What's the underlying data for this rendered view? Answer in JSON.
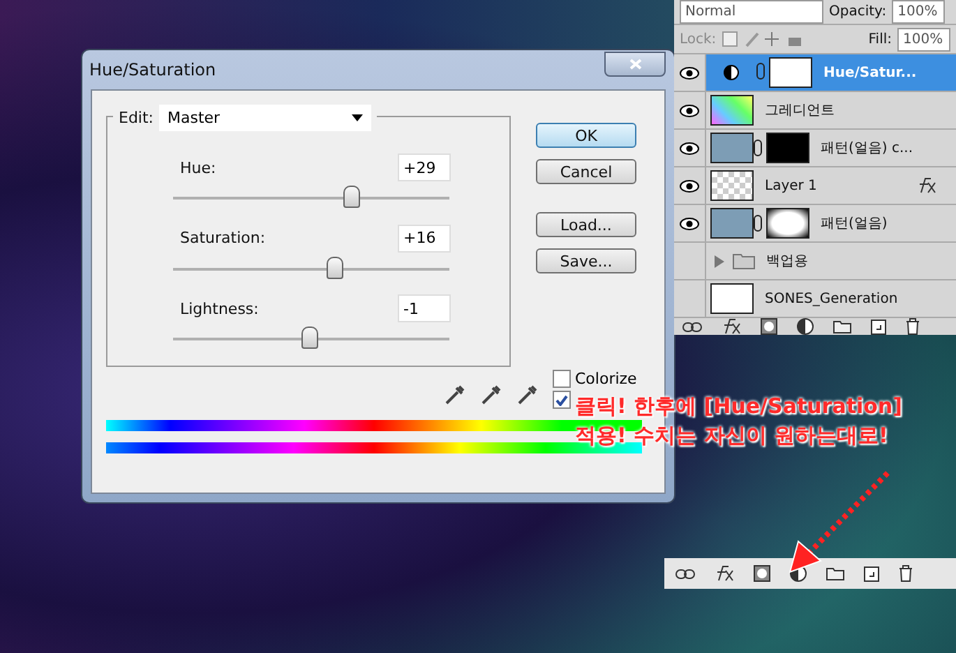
{
  "dialog": {
    "title": "Hue/Saturation",
    "edit_label": "Edit:",
    "edit_value": "Master",
    "sliders": [
      {
        "label": "Hue:",
        "value": "+29",
        "level": 0.64
      },
      {
        "label": "Saturation:",
        "value": "+16",
        "level": 0.58
      },
      {
        "label": "Lightness:",
        "value": "-1",
        "level": 0.49
      }
    ],
    "buttons": [
      {
        "label": "OK",
        "selected": true
      },
      {
        "label": "Cancel",
        "selected": false
      },
      {
        "label": "Load...",
        "selected": false
      },
      {
        "label": "Save...",
        "selected": false
      }
    ],
    "checkboxes": [
      {
        "label": "Colorize",
        "checked": false
      },
      {
        "checked": true
      }
    ]
  },
  "layers_panel": {
    "blend_mode": "Normal",
    "opacity_label": "Opacity:",
    "opacity": "100%",
    "lock_label": "Lock:",
    "fill_label": "Fill:",
    "fill": "100%",
    "layers": [
      {
        "name": "Hue/Satur...",
        "kind": "adjustment",
        "visible": true,
        "selected": true,
        "fx": false
      },
      {
        "name": "그레디언트",
        "kind": "gradient",
        "visible": true,
        "selected": false,
        "fx": false
      },
      {
        "name": "패턴(얼음) c...",
        "kind": "masked-text",
        "visible": true,
        "selected": false,
        "fx": false
      },
      {
        "name": "Layer 1",
        "kind": "plain",
        "visible": true,
        "selected": false,
        "fx": true
      },
      {
        "name": "패턴(얼음)",
        "kind": "masked",
        "visible": true,
        "selected": false,
        "fx": false
      },
      {
        "name": "백업용",
        "kind": "group",
        "visible": false,
        "selected": false,
        "fx": false
      },
      {
        "name": "SONES_Generation",
        "kind": "text",
        "visible": false,
        "selected": false,
        "fx": false
      }
    ]
  },
  "annotation": {
    "lines": [
      "클릭! 한후에 [Hue/Saturation]",
      "적용! 수치는 자신이 원하는대로!"
    ]
  }
}
